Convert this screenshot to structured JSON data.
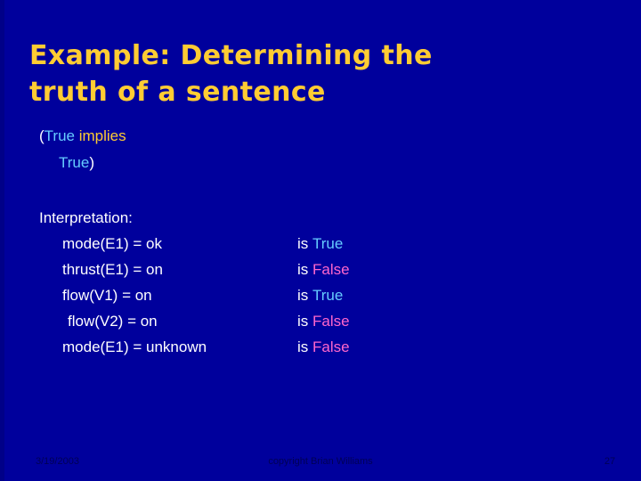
{
  "slide": {
    "background_color": "#00009c",
    "title": "Example: Determining the\ntruth of a sentence",
    "title_color": "#ffcc33"
  },
  "expression": {
    "line1": {
      "open_paren": "(",
      "operand": "True",
      "operator": "implies"
    },
    "line2": {
      "operand": "True",
      "close_paren": ")"
    }
  },
  "interpretation": {
    "heading": "Interpretation:",
    "rows": [
      {
        "assignment": "mode(E1) = ok",
        "is_label": "is",
        "value": "True",
        "value_color": "#66ccff"
      },
      {
        "assignment": "thrust(E1) = on",
        "is_label": "is",
        "value": "False",
        "value_color": "#ff66cc"
      },
      {
        "assignment": "flow(V1) = on",
        "is_label": "is",
        "value": "True",
        "value_color": "#66ccff"
      },
      {
        "assignment": "flow(V2) = on",
        "is_label": "is",
        "value": "False",
        "value_color": "#ff66cc"
      },
      {
        "assignment": "mode(E1) = unknown",
        "is_label": "is",
        "value": "False",
        "value_color": "#ff66cc"
      }
    ]
  },
  "footer": {
    "date": "3/19/2003",
    "copyright": "copyright Brian Williams",
    "page_number": "27"
  },
  "colors": {
    "true_color": "#66ccff",
    "false_color": "#ff66cc",
    "operator_color": "#ffcc33",
    "text_color": "#ffffff",
    "title_color": "#ffcc33",
    "background": "#00009c",
    "footer_text": "#000055"
  }
}
